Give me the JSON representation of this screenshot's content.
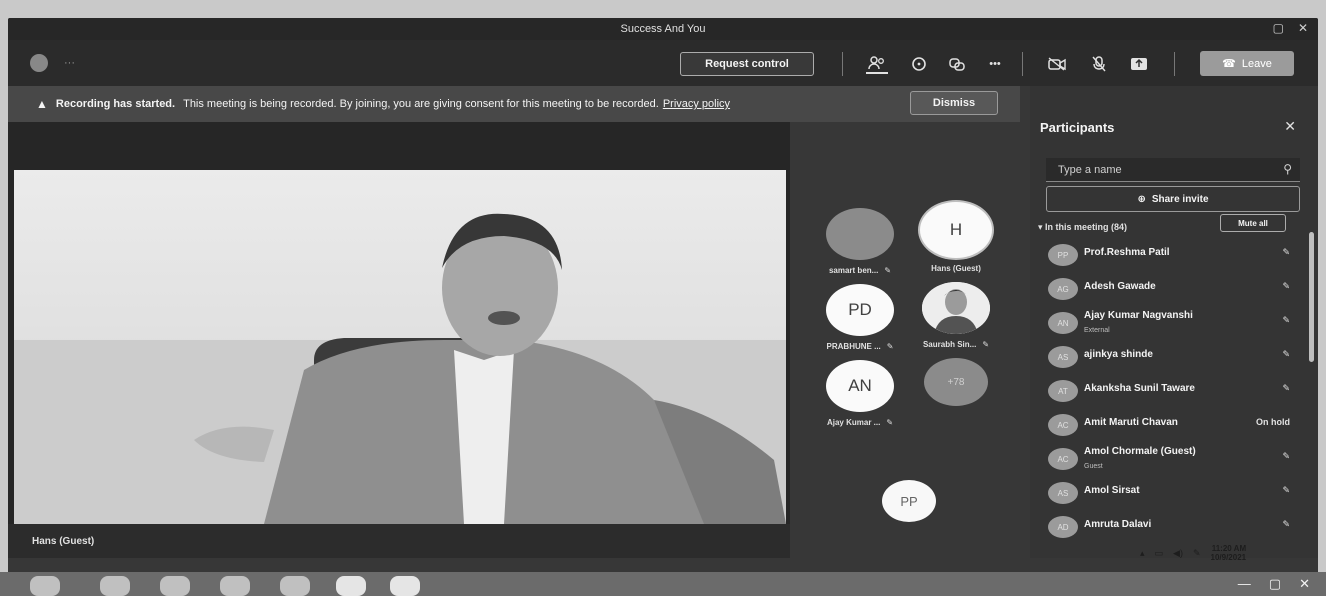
{
  "window": {
    "title": "Success And You",
    "app_dots": "···",
    "minimize_icon": "▢",
    "close_icon": "✕"
  },
  "toolbar": {
    "request_control": "Request control",
    "leave": "Leave",
    "more": "•••"
  },
  "banner": {
    "bold": "Recording has started.",
    "text": "This meeting is being recorded. By joining, you are giving consent for this meeting to be recorded.",
    "link": "Privacy policy",
    "dismiss": "Dismiss"
  },
  "stage": {
    "speaker_name": "Hans (Guest)",
    "tiles": [
      {
        "initials": "",
        "label": "samart ben..."
      },
      {
        "initials": "H",
        "label": "Hans (Guest)"
      },
      {
        "initials": "PD",
        "label": "PRABHUNE ..."
      },
      {
        "initials": "",
        "label": "Saurabh Sin..."
      },
      {
        "initials": "AN",
        "label": "Ajay Kumar ..."
      },
      {
        "initials": "+78",
        "label": ""
      }
    ],
    "floating_initials": "PP"
  },
  "panel": {
    "title": "Participants",
    "search_placeholder": "Type a name",
    "share_invite": "Share invite",
    "section": "In this meeting (84)",
    "mute_all": "Mute all",
    "participants": [
      {
        "initials": "PP",
        "name": "Prof.Reshma Patil",
        "sub": "",
        "status": ""
      },
      {
        "initials": "AG",
        "name": "Adesh Gawade",
        "sub": "",
        "status": ""
      },
      {
        "initials": "AN",
        "name": "Ajay Kumar Nagvanshi",
        "sub": "External",
        "status": ""
      },
      {
        "initials": "AS",
        "name": "ajinkya shinde",
        "sub": "",
        "status": ""
      },
      {
        "initials": "AT",
        "name": "Akanksha Sunil Taware",
        "sub": "",
        "status": ""
      },
      {
        "initials": "AC",
        "name": "Amit Maruti Chavan",
        "sub": "",
        "status": "On hold"
      },
      {
        "initials": "AC",
        "name": "Amol Chormale (Guest)",
        "sub": "Guest",
        "status": ""
      },
      {
        "initials": "AS",
        "name": "Amol Sirsat",
        "sub": "",
        "status": ""
      },
      {
        "initials": "AD",
        "name": "Amruta Dalavi",
        "sub": "",
        "status": ""
      }
    ]
  },
  "tray": {
    "time": "11:20 AM",
    "date": "10/9/2021"
  }
}
